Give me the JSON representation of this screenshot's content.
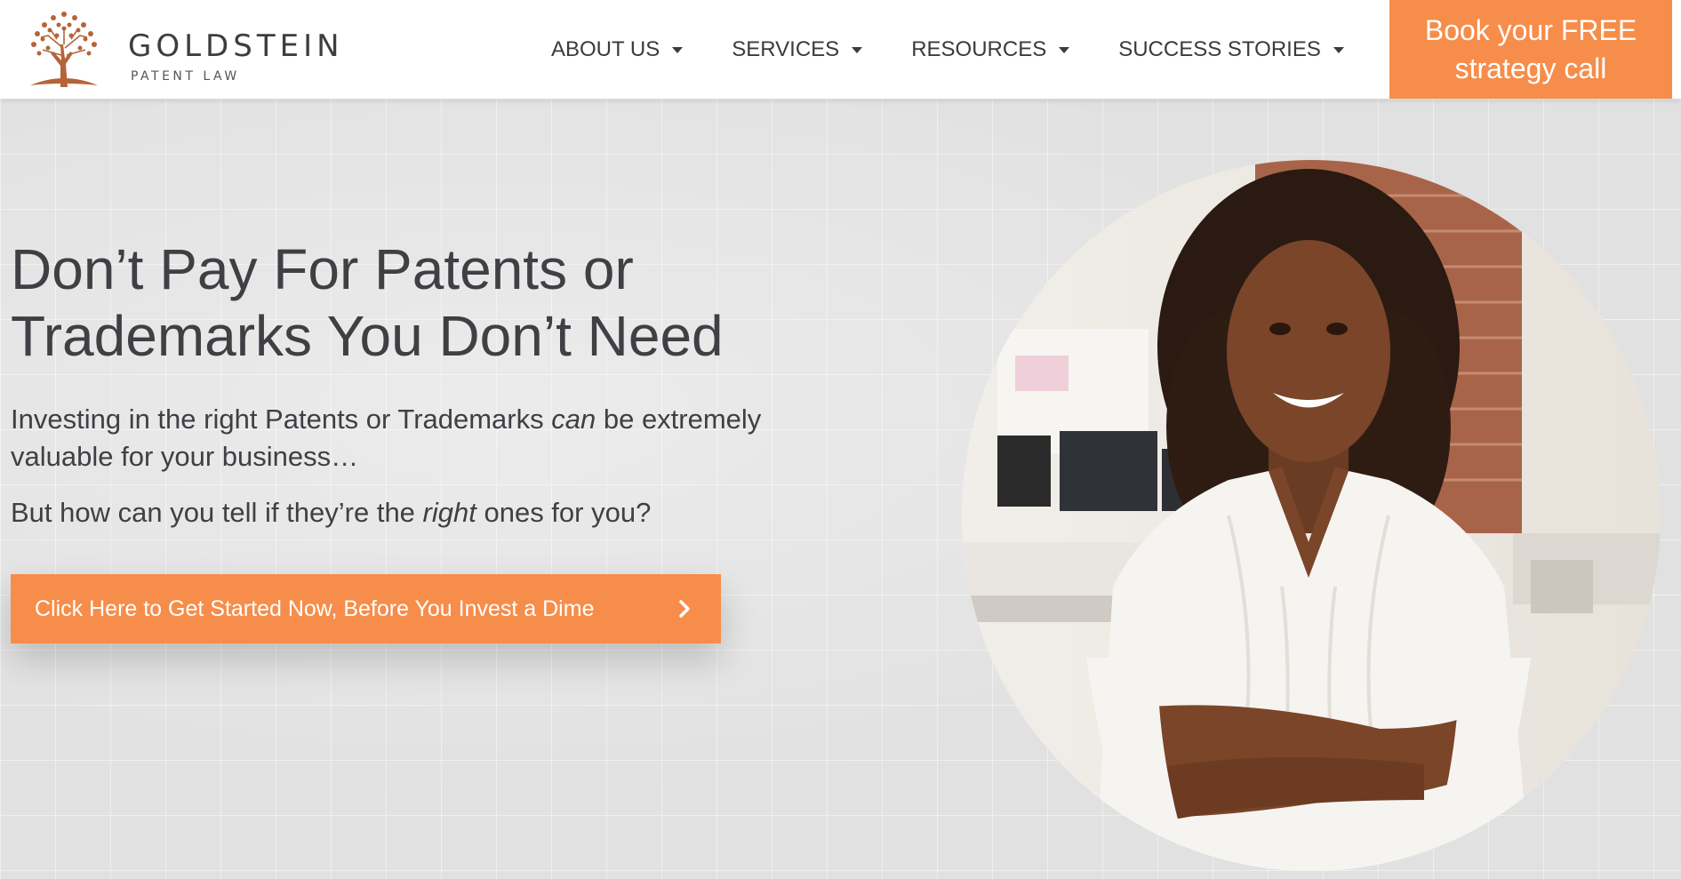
{
  "brand": {
    "name": "GOLDSTEIN",
    "tagline": "PATENT LAW",
    "logo_icon": "tree-icon",
    "accent_color": "#f68d4a",
    "logo_color": "#b5643a"
  },
  "nav": {
    "items": [
      {
        "label": "ABOUT US",
        "icon": "caret-down-icon"
      },
      {
        "label": "SERVICES",
        "icon": "caret-down-icon"
      },
      {
        "label": "RESOURCES",
        "icon": "caret-down-icon"
      },
      {
        "label": "SUCCESS STORIES",
        "icon": "caret-down-icon"
      }
    ],
    "cta_line1": "Book your FREE",
    "cta_line2": "strategy call"
  },
  "hero": {
    "headline_line1": "Don’t Pay For Patents or",
    "headline_line2": "Trademarks You Don’t Need",
    "para1_a": "Investing in the right Patents or Trademarks ",
    "para1_em": "can",
    "para1_b": " be extremely valuable for your business…",
    "para2_a": "But how can you tell if they’re the ",
    "para2_em": "right",
    "para2_b": " ones for you?",
    "cta_label": "Click Here to Get Started Now, Before You Invest a Dime",
    "cta_icon": "chevron-right-icon"
  }
}
